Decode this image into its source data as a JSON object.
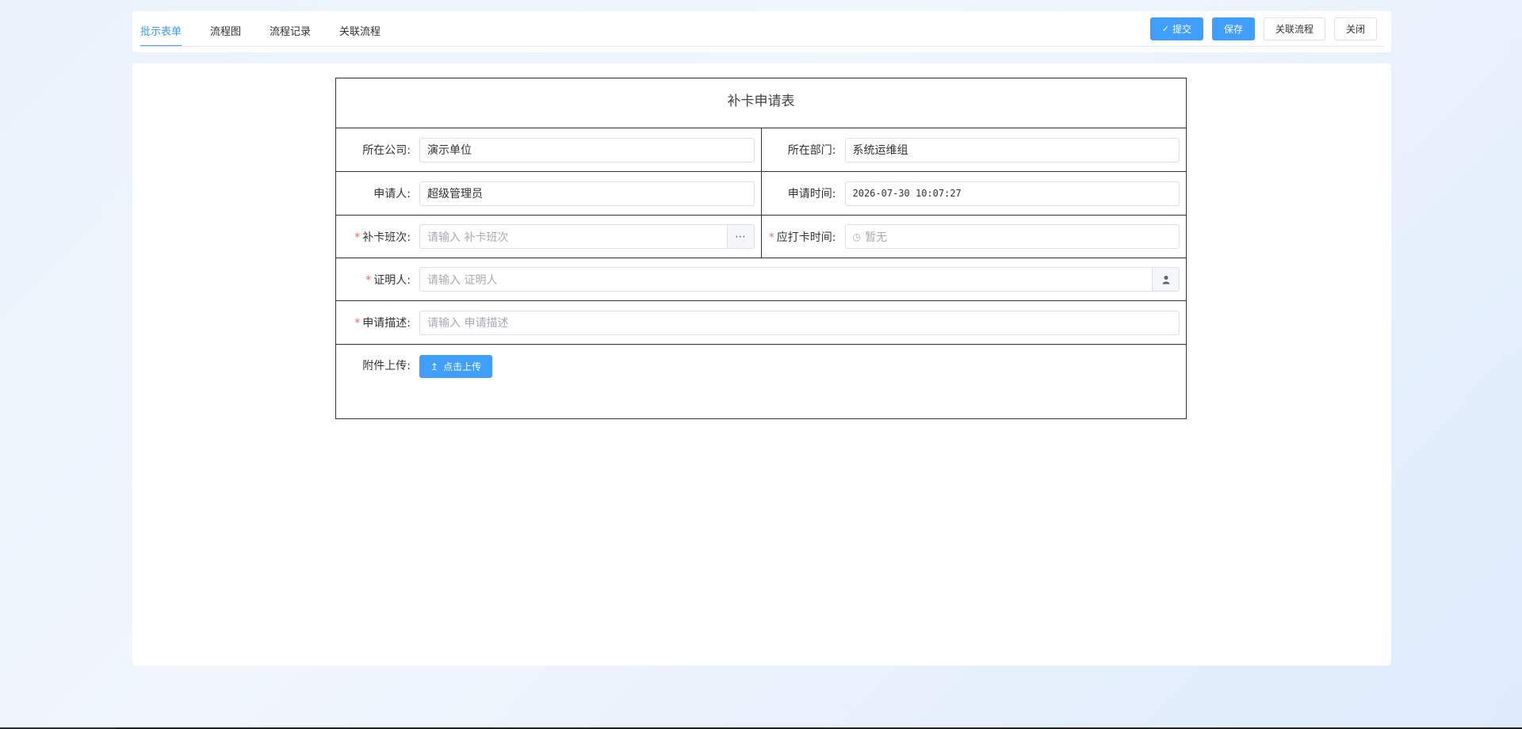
{
  "tabs": [
    {
      "label": "批示表单",
      "active": true
    },
    {
      "label": "流程图",
      "active": false
    },
    {
      "label": "流程记录",
      "active": false
    },
    {
      "label": "关联流程",
      "active": false
    }
  ],
  "actions": {
    "submit": "提交",
    "save": "保存",
    "related": "关联流程",
    "close": "关闭"
  },
  "form": {
    "title": "补卡申请表",
    "company": {
      "label": "所在公司:",
      "value": "演示单位"
    },
    "department": {
      "label": "所在部门:",
      "value": "系统运维组"
    },
    "applicant": {
      "label": "申请人:",
      "value": "超级管理员"
    },
    "apply_time": {
      "label": "申请时间:",
      "value": "2026-07-30 10:07:27"
    },
    "shift": {
      "label": "补卡班次:",
      "placeholder": "请输入 补卡班次",
      "required": true
    },
    "punch_time": {
      "label": "应打卡时间:",
      "placeholder": "暂无",
      "required": true
    },
    "witness": {
      "label": "证明人:",
      "placeholder": "请输入 证明人",
      "required": true
    },
    "description": {
      "label": "申请描述:",
      "placeholder": "请输入 申请描述",
      "required": true
    },
    "attachment": {
      "label": "附件上传:",
      "button": "点击上传"
    }
  },
  "colors": {
    "primary": "#409eff",
    "required": "#f56c6c"
  },
  "icons": {
    "submit": "check-icon",
    "shift_append": "more-dots-icon",
    "punch_time": "clock-icon",
    "witness_append": "user-icon",
    "upload": "upload-arrow-icon"
  }
}
